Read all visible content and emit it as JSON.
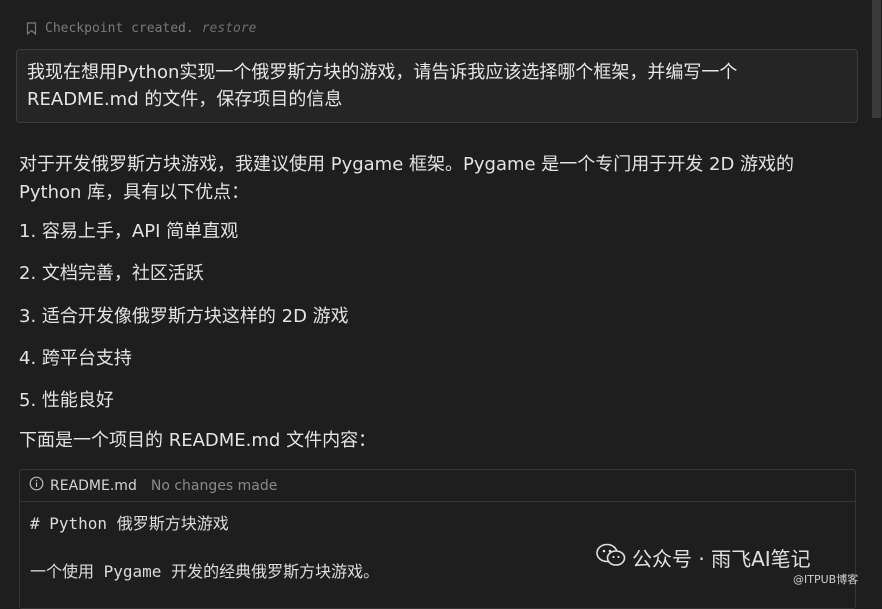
{
  "checkpoint": {
    "text": "Checkpoint created.",
    "restore": "restore"
  },
  "user_message": {
    "line1": "我现在想用Python实现一个俄罗斯方块的游戏，请告诉我应该选择哪个框架，并编写一个",
    "line2": "README.md 的文件，保存项目的信息"
  },
  "response": {
    "intro1": "对于开发俄罗斯方块游戏，我建议使用 Pygame 框架。Pygame 是一个专门用于开发 2D 游戏的",
    "intro2": "Python 库，具有以下优点：",
    "items": [
      "1. 容易上手，API 简单直观",
      "2. 文档完善，社区活跃",
      "3. 适合开发像俄罗斯方块这样的 2D 游戏",
      "4. 跨平台支持",
      "5. 性能良好"
    ],
    "readme_intro": "下面是一个项目的 README.md 文件内容："
  },
  "code_card": {
    "filename": "README.md",
    "status": "No changes made",
    "lines": [
      "# Python 俄罗斯方块游戏",
      "",
      "一个使用 Pygame 开发的经典俄罗斯方块游戏。"
    ]
  },
  "watermark": {
    "main": "公众号 · 雨飞AI笔记",
    "sub": "@ITPUB博客"
  }
}
